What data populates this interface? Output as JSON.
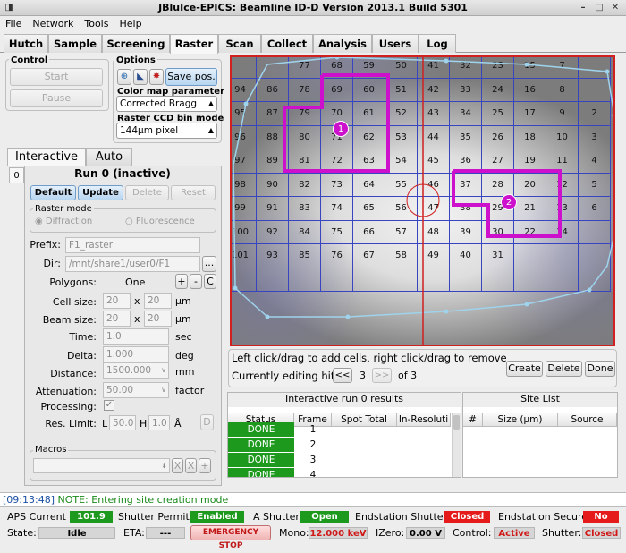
{
  "window": {
    "title": "JBluIce-EPICS: Beamline ID-D Version 2013.1 Build 5301"
  },
  "menu": [
    "File",
    "Network",
    "Tools",
    "Help"
  ],
  "tabs": [
    "Hutch",
    "Sample",
    "Screening",
    "Raster",
    "Scan",
    "Collect",
    "Analysis",
    "Users",
    "Log"
  ],
  "control": {
    "label": "Control",
    "start": "Start",
    "pause": "Pause"
  },
  "options": {
    "label": "Options",
    "save_pos": "Save pos.",
    "colormap_label": "Color map parameter",
    "colormap_value": "Corrected Bragg",
    "bin_label": "Raster CCD bin mode",
    "bin_value": "144µm pixel"
  },
  "subtabs": [
    "Interactive",
    "Auto"
  ],
  "side_index": "0",
  "run": {
    "title": "Run 0 (inactive)",
    "buttons": [
      "Default",
      "Update",
      "Delete",
      "Reset"
    ],
    "raster_mode_label": "Raster mode",
    "mode_diffraction": "Diffraction",
    "mode_fluorescence": "Fluorescence",
    "prefix_label": "Prefix:",
    "prefix": "F1_raster",
    "dir_label": "Dir:",
    "dir": "/mnt/share1/user0/F1",
    "browse": "...",
    "polygons_label": "Polygons:",
    "polygons": "One",
    "plus": "+",
    "minus": "-",
    "clear": "C",
    "cell_label": "Cell size:",
    "cell_w": "20",
    "cell_h": "20",
    "cell_unit": "µm",
    "beam_label": "Beam size:",
    "beam_w": "20",
    "beam_h": "20",
    "beam_unit": "µm",
    "x": "x",
    "time_label": "Time:",
    "time": "1.0",
    "time_unit": "sec",
    "delta_label": "Delta:",
    "delta": "1.000",
    "delta_unit": "deg",
    "distance_label": "Distance:",
    "distance": "1500.000",
    "distance_unit": "mm",
    "atten_label": "Attenuation:",
    "atten": "50.00",
    "atten_unit": "factor",
    "processing_label": "Processing:",
    "res_label": "Res. Limit:",
    "res_l_label": "L",
    "res_l": "50.0",
    "res_h_label": "H",
    "res_h": "1.0",
    "res_unit": "Å",
    "res_d": "D",
    "macros_label": "Macros",
    "macro_x": "X",
    "macro_plus": "+"
  },
  "grid": {
    "rows": [
      [
        "",
        "",
        "77",
        "68",
        "59",
        "50",
        "41",
        "32",
        "23",
        "15",
        "7",
        ""
      ],
      [
        "94",
        "86",
        "78",
        "69",
        "60",
        "51",
        "42",
        "33",
        "24",
        "16",
        "8",
        ""
      ],
      [
        "95",
        "87",
        "79",
        "70",
        "61",
        "52",
        "43",
        "34",
        "25",
        "17",
        "9",
        "2"
      ],
      [
        "96",
        "88",
        "80",
        "71",
        "62",
        "53",
        "44",
        "35",
        "26",
        "18",
        "10",
        "3"
      ],
      [
        "97",
        "89",
        "81",
        "72",
        "63",
        "54",
        "45",
        "36",
        "27",
        "19",
        "11",
        "4"
      ],
      [
        "98",
        "90",
        "82",
        "73",
        "64",
        "55",
        "46",
        "37",
        "28",
        "20",
        "12",
        "5"
      ],
      [
        "99",
        "91",
        "83",
        "74",
        "65",
        "56",
        "47",
        "38",
        "29",
        "21",
        "13",
        "6"
      ],
      [
        "100",
        "92",
        "84",
        "75",
        "66",
        "57",
        "48",
        "39",
        "30",
        "22",
        "14",
        ""
      ],
      [
        "101",
        "93",
        "85",
        "76",
        "67",
        "58",
        "49",
        "40",
        "31",
        "",
        "",
        ""
      ],
      [
        "",
        "",
        "",
        "",
        "",
        "",
        "",
        "",
        "",
        "",
        "",
        ""
      ]
    ],
    "markers": [
      "1",
      "2"
    ]
  },
  "hint": "Left click/drag to add cells, right click/drag to remove",
  "editing": {
    "label": "Currently editing hit",
    "prev": "<<",
    "current": "3",
    "next": ">>",
    "of": "of 3"
  },
  "actions": [
    "Create",
    "Delete",
    "Done"
  ],
  "results": {
    "title": "Interactive run 0 results",
    "columns": [
      "Status",
      "Frame",
      "Spot Total",
      "In-Resoluti"
    ],
    "rows": [
      {
        "status": "DONE",
        "frame": "1"
      },
      {
        "status": "DONE",
        "frame": "2"
      },
      {
        "status": "DONE",
        "frame": "3"
      },
      {
        "status": "DONE",
        "frame": "4"
      }
    ]
  },
  "sitelist": {
    "title": "Site List",
    "columns": [
      "#",
      "Size (µm)",
      "Source"
    ]
  },
  "log": {
    "time": "[09:13:48]",
    "message": "NOTE: Entering site creation mode"
  },
  "status": {
    "aps_label": "APS Current",
    "aps": "101.9",
    "shutter_permit_label": "Shutter Permit",
    "shutter_permit": "Enabled",
    "a_shutter_label": "A Shutter",
    "a_shutter": "Open",
    "endstation_shutter_label": "Endstation Shutter",
    "endstation_shutter": "Closed",
    "endstation_secure_label": "Endstation Secure",
    "endstation_secure": "No",
    "state_label": "State:",
    "state": "Idle",
    "eta_label": "ETA:",
    "eta": "---",
    "estop": "EMERGENCY STOP",
    "mono_label": "Mono:",
    "mono": "12.000 keV",
    "izero_label": "IZero:",
    "izero": "0.00 V",
    "control_label": "Control:",
    "control": "Active",
    "shutter_label": "Shutter:",
    "shutter": "Closed"
  }
}
